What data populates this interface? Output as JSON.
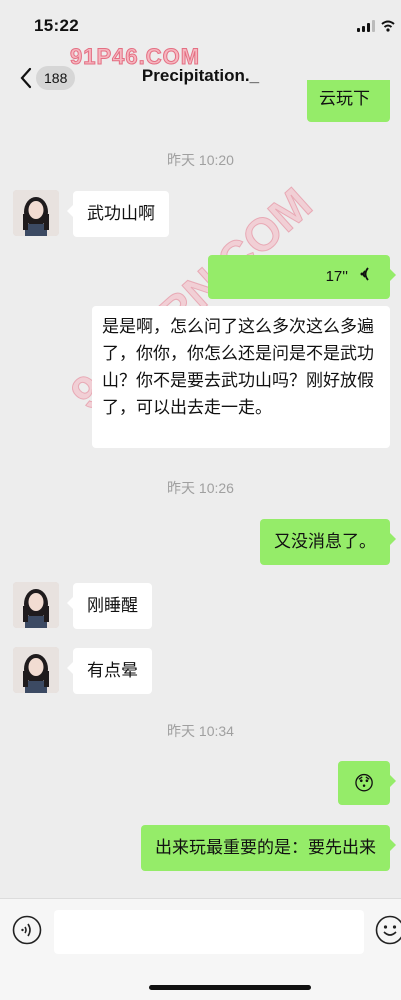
{
  "status": {
    "time": "15:22"
  },
  "watermark": {
    "top": "91P46.COM",
    "diagonal": "91PORN.COM"
  },
  "nav": {
    "back_count": "188",
    "title": "Precipitation._"
  },
  "messages": {
    "top_partial": "云玩下",
    "ts1": "昨天 10:20",
    "in1": "武功山啊",
    "voice_duration": "17''",
    "transcript": "是是啊，怎么问了这么多次这么多遍了，你你，你怎么还是问是不是武功山？你不是要去武功山吗？刚好放假了，可以出去走一走。",
    "ts2": "昨天 10:26",
    "out1": "又没消息了。",
    "in2": "刚睡醒",
    "in3": "有点晕",
    "ts3": "昨天 10:34",
    "emoji": "😯",
    "out2": "出来玩最重要的是：要先出来"
  },
  "colors": {
    "sent_bubble": "#95ec69",
    "received_bubble": "#ffffff",
    "background": "#ededed"
  }
}
